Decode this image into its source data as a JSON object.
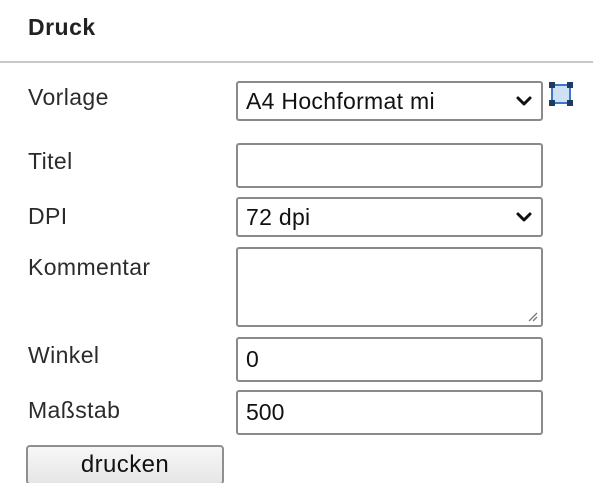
{
  "panel": {
    "title": "Druck"
  },
  "form": {
    "vorlage": {
      "label": "Vorlage",
      "selected": "A4 Hochformat mi"
    },
    "titel": {
      "label": "Titel",
      "value": ""
    },
    "dpi": {
      "label": "DPI",
      "selected": "72 dpi"
    },
    "kommentar": {
      "label": "Kommentar",
      "value": ""
    },
    "winkel": {
      "label": "Winkel",
      "value": "0"
    },
    "massstab": {
      "label": "Maßstab",
      "value": "500"
    }
  },
  "actions": {
    "print_label": "drucken"
  },
  "icons": {
    "print_frame": "square-selection-icon",
    "select_arrow": "chevron-down-icon",
    "resize": "resize-grip-icon"
  },
  "colors": {
    "frame_fill": "#cfe0f5",
    "frame_stroke": "#3a78c9",
    "frame_handles": "#1e3b63"
  }
}
